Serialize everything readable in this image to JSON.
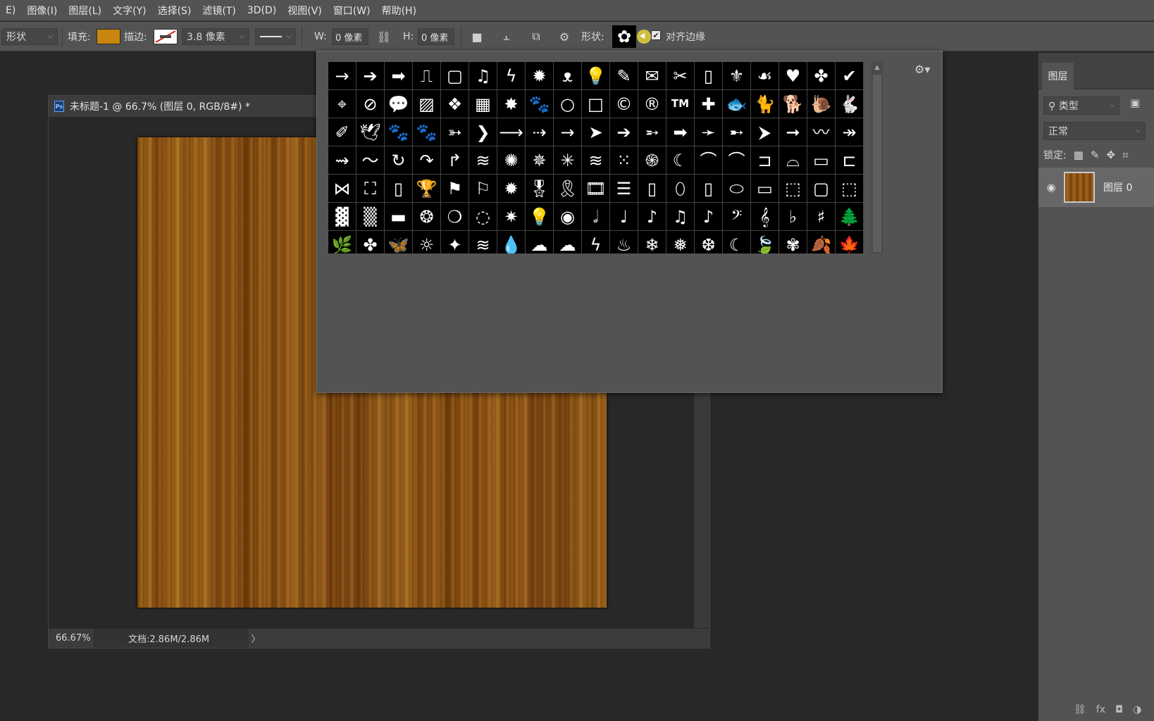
{
  "menu": {
    "items": [
      "E)",
      "图像(I)",
      "图层(L)",
      "文字(Y)",
      "选择(S)",
      "滤镜(T)",
      "3D(D)",
      "视图(V)",
      "窗口(W)",
      "帮助(H)"
    ]
  },
  "options": {
    "mode": "形状",
    "fill_label": "填充:",
    "fill_color": "#c8860c",
    "stroke_label": "描边:",
    "stroke_width": "3.8 像素",
    "w_label": "W:",
    "w_value": "0 像素",
    "h_label": "H:",
    "h_value": "0 像素",
    "shape_label": "形状:",
    "current_shape": "✿",
    "align_edges": "对齐边缘"
  },
  "document": {
    "title": "未标题-1 @ 66.7% (图层 0, RGB/8#) *",
    "zoom": "66.67%",
    "doc_size": "文档:2.86M/2.86M",
    "arrow": "〉"
  },
  "shape_picker": {
    "cells": [
      "→",
      "➔",
      "➡",
      "⎍",
      "▢",
      "♫",
      "ϟ",
      "✹",
      "ᴥ",
      "💡",
      "✎",
      "✉",
      "✂",
      "▯",
      "⚜",
      "☙",
      "♥",
      "✤",
      "✔",
      "⌖",
      "⊘",
      "💬",
      "▨",
      "❖",
      "▦",
      "✸",
      "🐾",
      "○",
      "□",
      "©",
      "®",
      "TM",
      "✚",
      "🐟",
      "🐈",
      "🐕",
      "🐌",
      "🐇",
      "✐",
      "🕊",
      "🐾",
      "🐾",
      "➳",
      "❯",
      "⟶",
      "⇢",
      "→",
      "➤",
      "➔",
      "➵",
      "➡",
      "➛",
      "➸",
      "⮞",
      "➞",
      "〰",
      "↠",
      "⇝",
      "〜",
      "↻",
      "↷",
      "↱",
      "≋",
      "✺",
      "✵",
      "✳",
      "≋",
      "⁙",
      "֍",
      "☾",
      "⌒",
      "⌒",
      "⊐",
      "⌓",
      "▭",
      "⊏",
      "⋈",
      "⛶",
      "▯",
      "🏆",
      "⚑",
      "⚐",
      "✹",
      "🎖",
      "🎗",
      "🎞",
      "☰",
      "▯",
      "⬯",
      "▯",
      "⬭",
      "▭",
      "⬚",
      "▢",
      "⬚",
      "▓",
      "▒",
      "▬",
      "❂",
      "❍",
      "◌",
      "✷",
      "💡",
      "◉",
      "𝅗𝅥",
      "♩",
      "♪",
      "♫",
      "♪",
      "𝄢",
      "𝄞",
      "♭",
      "♯",
      "🌲",
      "🌿",
      "✤",
      "🦋",
      "☼",
      "✦",
      "≋",
      "💧",
      "☁",
      "☁",
      "ϟ",
      "♨",
      "❄",
      "❅",
      "❆",
      "☾",
      "🍃",
      "✾",
      "🍂",
      "🍁"
    ]
  },
  "layers": {
    "tab": "图层",
    "filter": "类型",
    "blend_mode": "正常",
    "lock_label": "锁定:",
    "layer_name": "图层 0",
    "footer": [
      "⛓",
      "fx",
      "◘",
      "◑"
    ]
  }
}
